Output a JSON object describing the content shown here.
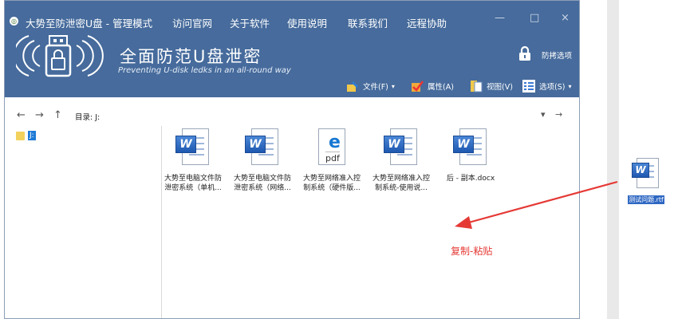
{
  "window": {
    "app_title": "大势至防泄密U盘 - 管理模式",
    "menu": [
      "访问官网",
      "关于软件",
      "使用说明",
      "联系我们",
      "远程协助"
    ],
    "controls": [
      "—",
      "□",
      "×"
    ]
  },
  "brand": {
    "title": "全面防范U盘泄密",
    "subtitle": "Preventing U-disk ledks in an all-round way"
  },
  "lock_label": "防拷选项",
  "toolbar": {
    "file": "文件(F)",
    "properties": "属性(A)",
    "view": "视图(V)",
    "options": "选项(S)"
  },
  "address": {
    "back": "←",
    "forward": "→",
    "up": "↑",
    "label": "目录: J:",
    "dropdown": "▾",
    "go": "→"
  },
  "tree": {
    "item": "J:"
  },
  "files": [
    {
      "type": "word",
      "line1": "大势至电脑文件防",
      "line2": "泄密系统（单机..."
    },
    {
      "type": "word",
      "line1": "大势至电脑文件防",
      "line2": "泄密系统（网络..."
    },
    {
      "type": "pdf",
      "line1": "大势至网络准入控",
      "line2": "制系统（硬件版..."
    },
    {
      "type": "word",
      "line1": "大势至网络准入控",
      "line2": "制系统-使用说..."
    },
    {
      "type": "word",
      "line1": "后 - 副本.docx",
      "line2": ""
    }
  ],
  "icon_text": {
    "word": "W",
    "pdf_e": "e",
    "pdf_t": "pdf"
  },
  "annotation": {
    "text": "复制-粘贴",
    "color": "#e53935"
  },
  "desktop_file": {
    "name": "测试问题.rtf"
  },
  "colors": {
    "banner": "#466b9c",
    "accent": "#1e7bd6"
  }
}
